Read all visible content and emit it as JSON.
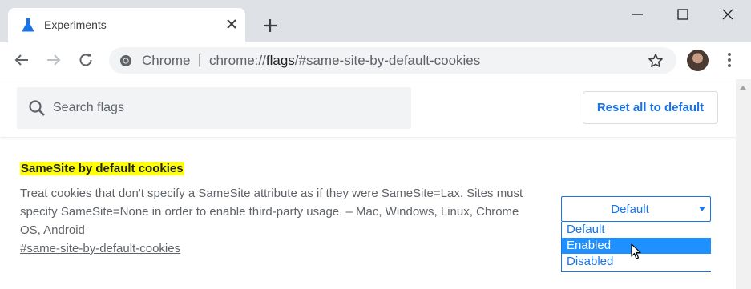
{
  "window": {
    "tab": {
      "title": "Experiments",
      "favicon": "flask-icon"
    }
  },
  "toolbar": {
    "site_chip": "Chrome",
    "separator": "|",
    "url_scheme": "chrome://",
    "url_host": "flags",
    "url_path": "/#same-site-by-default-cookies"
  },
  "header": {
    "search_placeholder": "Search flags",
    "reset_label": "Reset all to default"
  },
  "flag": {
    "name": "SameSite by default cookies",
    "description": "Treat cookies that don't specify a SameSite attribute as if they were SameSite=Lax. Sites must specify SameSite=None in order to enable third-party usage. – Mac, Windows, Linux, Chrome OS, Android",
    "link": "#same-site-by-default-cookies",
    "select": {
      "value": "Default",
      "options": [
        "Default",
        "Enabled",
        "Disabled"
      ],
      "highlighted_index": 1
    }
  },
  "colors": {
    "accent": "#1a73e8",
    "highlight": "#ffff00",
    "option_hover": "#1e90ff"
  }
}
